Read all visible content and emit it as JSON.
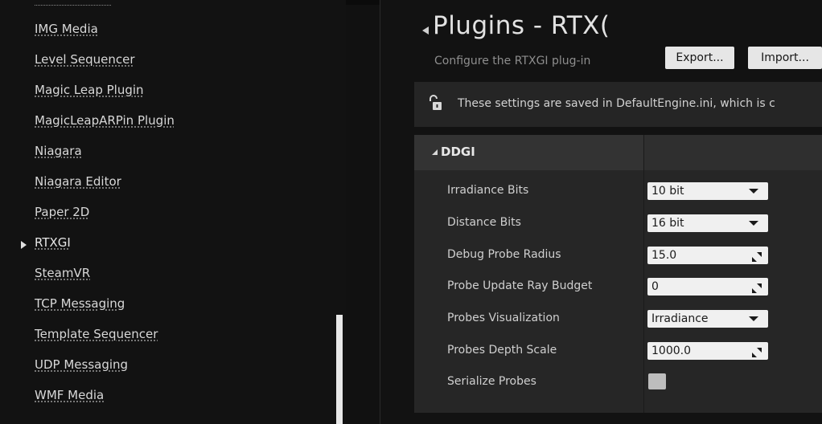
{
  "sidebar": {
    "items": [
      {
        "label": "IMG Media"
      },
      {
        "label": "Level Sequencer"
      },
      {
        "label": "Magic Leap Plugin"
      },
      {
        "label": "MagicLeapARPin Plugin"
      },
      {
        "label": "Niagara"
      },
      {
        "label": "Niagara Editor"
      },
      {
        "label": "Paper 2D"
      },
      {
        "label": "RTXGI"
      },
      {
        "label": "SteamVR"
      },
      {
        "label": "TCP Messaging"
      },
      {
        "label": "Template Sequencer"
      },
      {
        "label": "UDP Messaging"
      },
      {
        "label": "WMF Media"
      }
    ],
    "active_item": "RTXGI"
  },
  "header": {
    "title": "Plugins - RTX(",
    "description": "Configure the RTXGI plug-in",
    "export_label": "Export...",
    "import_label": "Import..."
  },
  "notice": {
    "text": "These settings are saved in DefaultEngine.ini, which is c",
    "icon": "unlocked-padlock-icon"
  },
  "section": {
    "title": "DDGI",
    "properties": [
      {
        "label": "Irradiance Bits",
        "value": "10 bit",
        "type": "dropdown"
      },
      {
        "label": "Distance Bits",
        "value": "16 bit",
        "type": "dropdown"
      },
      {
        "label": "Debug Probe Radius",
        "value": "15.0",
        "type": "numeric"
      },
      {
        "label": "Probe Update Ray Budget",
        "value": "0",
        "type": "numeric"
      },
      {
        "label": "Probes Visualization",
        "value": "Irradiance",
        "type": "dropdown"
      },
      {
        "label": "Probes Depth Scale",
        "value": "1000.0",
        "type": "numeric"
      },
      {
        "label": "Serialize Probes",
        "value": "",
        "type": "checkbox",
        "checked": false
      }
    ]
  },
  "colors": {
    "background": "#111111",
    "panel": "#262626",
    "field": "#f0f0f0",
    "button": "#e6e6e6"
  }
}
